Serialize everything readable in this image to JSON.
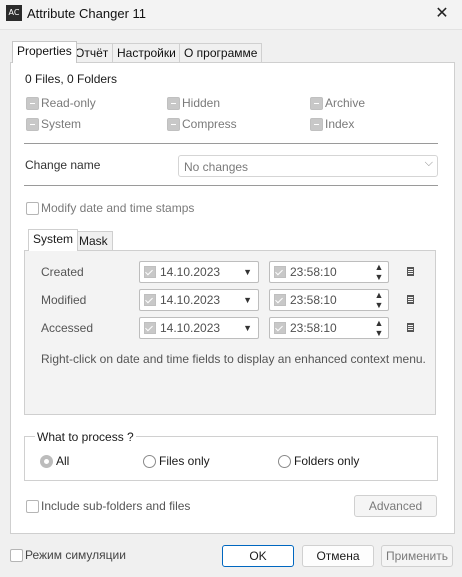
{
  "window": {
    "title": "Attribute Changer 11",
    "icon_text": "AC"
  },
  "tabs": [
    "Properties",
    "Отчёт",
    "Настройки",
    "О программе"
  ],
  "files_summary": "0 Files, 0 Folders",
  "attributes": [
    "Read-only",
    "Hidden",
    "Archive",
    "System",
    "Compress",
    "Index"
  ],
  "change_name": {
    "label": "Change name",
    "value": "No changes"
  },
  "modify_stamps": "Modify date and time stamps",
  "inner_tabs": [
    "System",
    "Mask"
  ],
  "stamps": [
    {
      "label": "Created",
      "date": "14.10.2023",
      "time": "23:58:10"
    },
    {
      "label": "Modified",
      "date": "14.10.2023",
      "time": "23:58:10"
    },
    {
      "label": "Accessed",
      "date": "14.10.2023",
      "time": "23:58:10"
    }
  ],
  "hint": "Right-click on date and time fields to display an enhanced context menu.",
  "what_to_process": {
    "title": "What to process ?",
    "options": [
      "All",
      "Files only",
      "Folders only"
    ],
    "selected": "All"
  },
  "include_sub": "Include sub-folders and files",
  "advanced": "Advanced",
  "simulation": "Режим симуляции",
  "buttons": {
    "ok": "OK",
    "cancel": "Отмена",
    "apply": "Применить"
  },
  "icons": {
    "close": "close-icon",
    "dropdown": "chevron-down-icon",
    "calendar": "calendar-icon"
  },
  "colors": {
    "primary_border": "#0067c0",
    "disabled_check": "#c8c8c8"
  }
}
